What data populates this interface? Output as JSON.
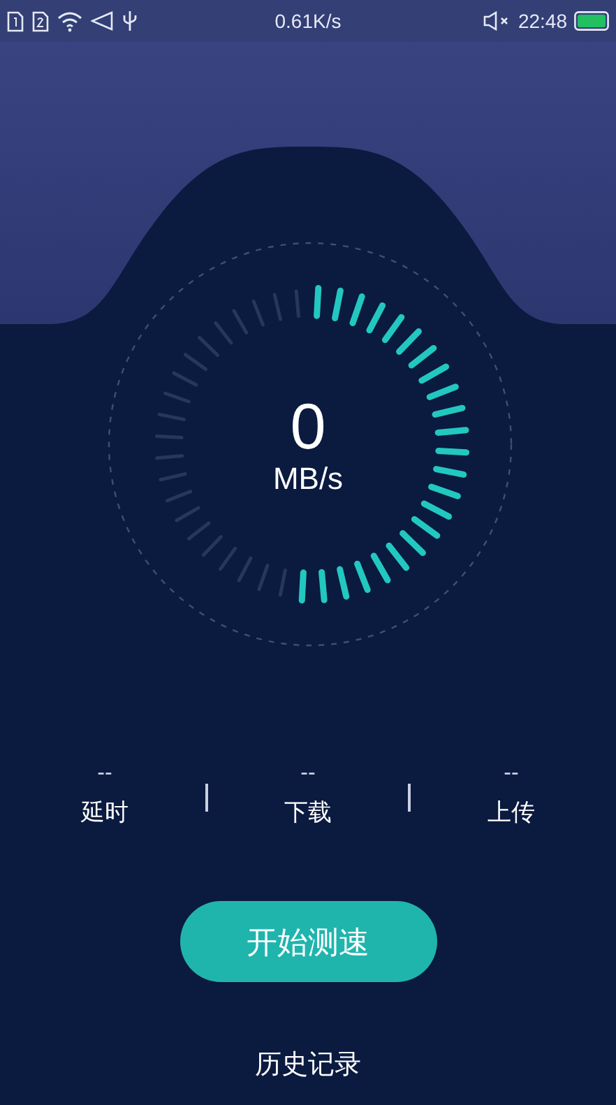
{
  "status_bar": {
    "network_speed": "0.61K/s",
    "time": "22:48"
  },
  "gauge": {
    "value": "0",
    "unit": "MB/s"
  },
  "stats": [
    {
      "value": "--",
      "label": "延时"
    },
    {
      "value": "--",
      "label": "下载"
    },
    {
      "value": "--",
      "label": "上传"
    }
  ],
  "start_button": "开始测速",
  "history_link": "历史记录"
}
